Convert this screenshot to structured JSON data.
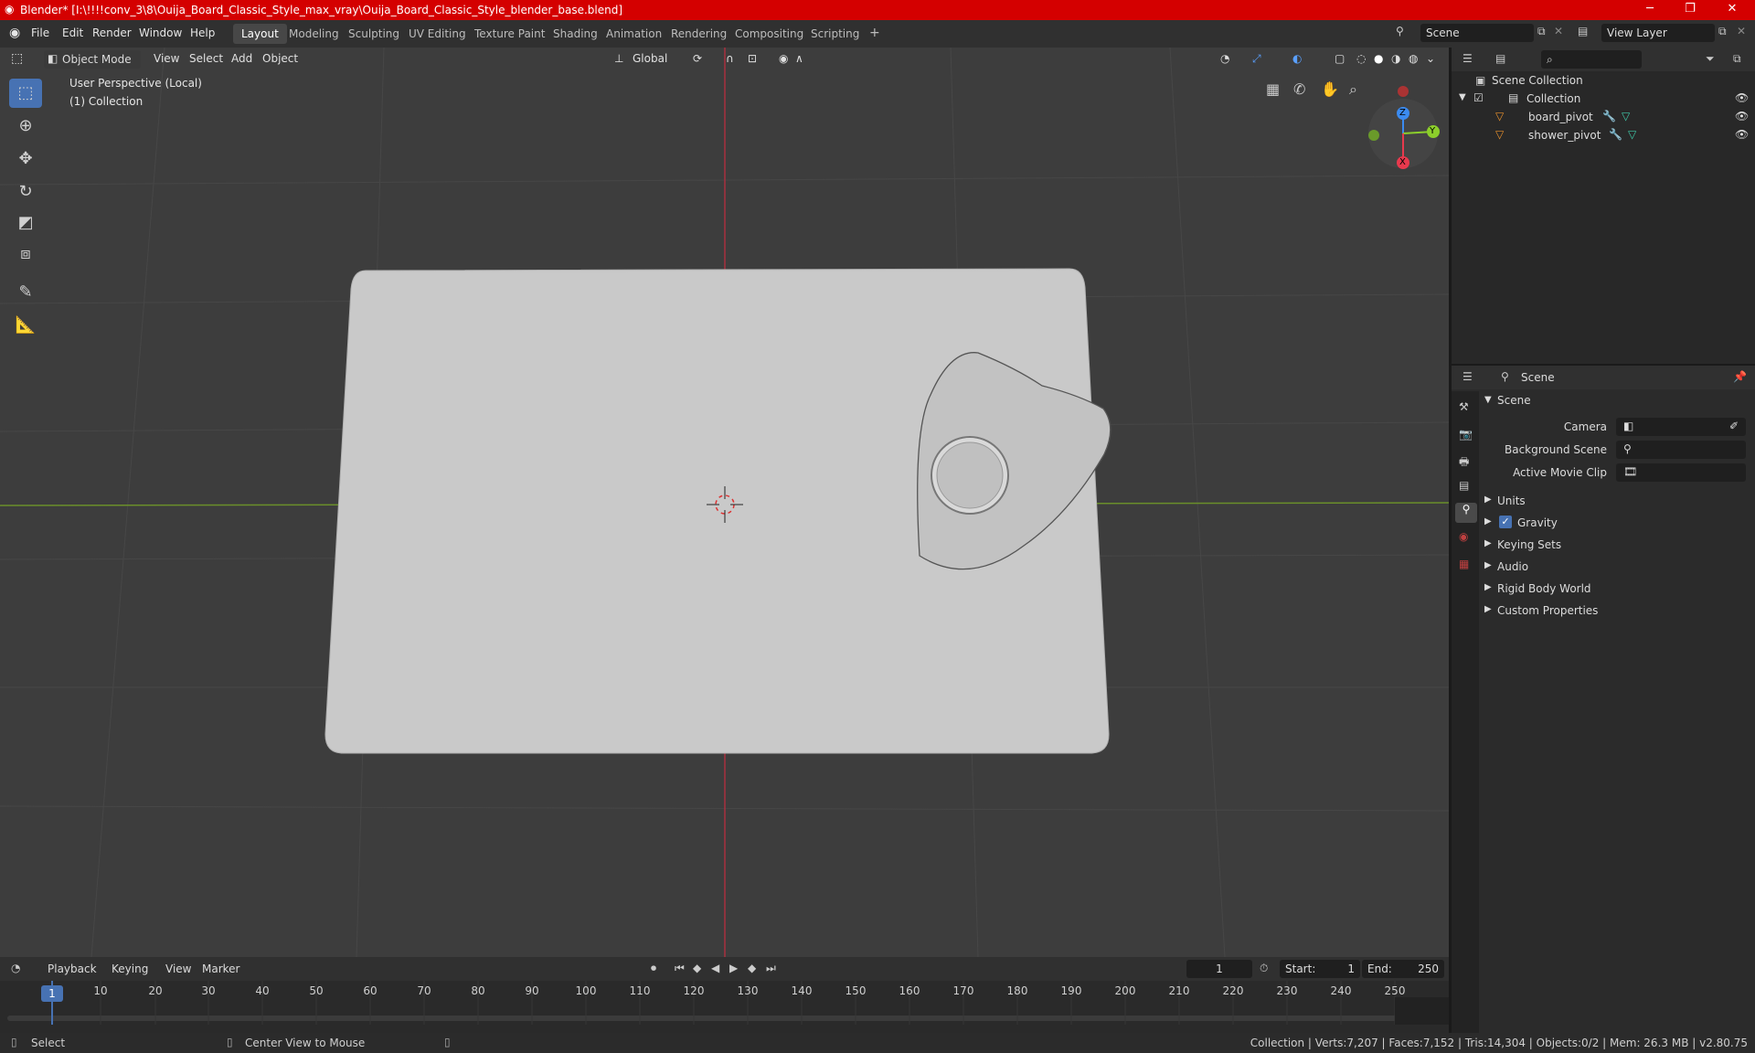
{
  "window": {
    "title": "Blender* [I:\\!!!!conv_3\\8\\Ouija_Board_Classic_Style_max_vray\\Ouija_Board_Classic_Style_blender_base.blend]",
    "minimize": "─",
    "maximize": "❐",
    "close": "✕"
  },
  "menu": [
    "File",
    "Edit",
    "Render",
    "Window",
    "Help"
  ],
  "workspaces": [
    "Layout",
    "Modeling",
    "Sculpting",
    "UV Editing",
    "Texture Paint",
    "Shading",
    "Animation",
    "Rendering",
    "Compositing",
    "Scripting"
  ],
  "workspace_add": "+",
  "scene_field": "Scene",
  "view_layer_field": "View Layer",
  "viewport_header": {
    "mode": "Object Mode",
    "view": "View",
    "select": "Select",
    "add": "Add",
    "object": "Object",
    "transform_orientation": "Global"
  },
  "viewport_overlay": {
    "perspective": "User Perspective (Local)",
    "collection": "(1) Collection"
  },
  "gizmo": {
    "z": "Z",
    "y": "Y",
    "x": "X"
  },
  "outliner": {
    "root": "Scene Collection",
    "collection": "Collection",
    "items": [
      "board_pivot",
      "shower_pivot"
    ]
  },
  "properties": {
    "header": "Scene",
    "panel": "Scene",
    "fields": [
      {
        "label": "Camera",
        "value": ""
      },
      {
        "label": "Background Scene",
        "value": ""
      },
      {
        "label": "Active Movie Clip",
        "value": ""
      }
    ],
    "sections": [
      "Units",
      "Gravity",
      "Keying Sets",
      "Audio",
      "Rigid Body World",
      "Custom Properties"
    ],
    "gravity_checked": true
  },
  "timeline": {
    "playback": "Playback",
    "keying": "Keying",
    "view": "View",
    "marker": "Marker",
    "current_frame": "1",
    "start_label": "Start:",
    "start": "1",
    "end_label": "End:",
    "end": "250",
    "ticks": [
      "10",
      "20",
      "30",
      "40",
      "50",
      "60",
      "70",
      "80",
      "90",
      "100",
      "110",
      "120",
      "130",
      "140",
      "150",
      "160",
      "170",
      "180",
      "190",
      "200",
      "210",
      "220",
      "230",
      "240",
      "250"
    ],
    "playhead": "1"
  },
  "status": {
    "left": "Select",
    "middle": "Center View to Mouse",
    "right": "Collection | Verts:7,207 | Faces:7,152 | Tris:14,304 | Objects:0/2 | Mem: 26.3 MB | v2.80.75"
  },
  "colors": {
    "title_bar": "#d40000",
    "accent": "#4772b3",
    "x_axis": "#e8394d",
    "y_axis": "#8ccf2b",
    "z_axis": "#3b8bf0"
  }
}
